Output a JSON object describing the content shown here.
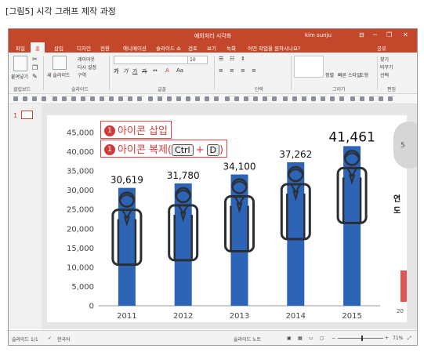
{
  "caption": "[그림5] 시각 그래프 제작 과정",
  "window": {
    "title": "예외처리 시각화",
    "user": "kim sunju",
    "buttons": {
      "ribbon_toggle": "⊟",
      "minimize": "─",
      "restore": "❐",
      "close": "✕"
    },
    "accent": "#c3482b"
  },
  "tabs": [
    {
      "label": "파일"
    },
    {
      "label": "홈"
    },
    {
      "label": "삽입"
    },
    {
      "label": "디자인"
    },
    {
      "label": "전환"
    },
    {
      "label": "애니메이션"
    },
    {
      "label": "슬라이드 쇼"
    },
    {
      "label": "검토"
    },
    {
      "label": "보기"
    },
    {
      "label": "녹화"
    },
    {
      "label": "어떤 작업을 원하시나요?"
    }
  ],
  "tabs_extra": {
    "share": "공유"
  },
  "ribbon": {
    "clipboard": {
      "paste": "붙여넣기",
      "group": "클립보드"
    },
    "slides": {
      "new_slide": "새 슬라이드",
      "layout": "레이아웃",
      "reset": "다시 설정",
      "section": "구역",
      "group": "슬라이드"
    },
    "font": {
      "font_name": "",
      "font_size": "10",
      "group": "글꼴"
    },
    "paragraph": {
      "group": "단락"
    },
    "drawing": {
      "arrange": "정렬",
      "quick_styles": "빠른 스타일",
      "shape": "도형",
      "group": "그리기"
    },
    "editing": {
      "find": "찾기",
      "replace": "바꾸기",
      "select": "선택",
      "group": "편집"
    }
  },
  "thumbnail": {
    "number": "1"
  },
  "annotations": {
    "step1_number": "1",
    "step1_text": "아이콘 삽입",
    "step2_number": "1",
    "step2_text": "아이콘 복제(",
    "key1": "Ctrl",
    "plus": "+",
    "key2": "D",
    "close_paren": ")"
  },
  "side_peek": {
    "text": "연도",
    "circle_label": "5",
    "axis_partial": "20"
  },
  "chart_data": {
    "type": "bar",
    "categories": [
      "2011",
      "2012",
      "2013",
      "2014",
      "2015"
    ],
    "values": [
      30619,
      31780,
      34100,
      37262,
      41461
    ],
    "data_labels": [
      "30,619",
      "31,780",
      "34,100",
      "37,262",
      "41,461"
    ],
    "y_ticks": [
      "0",
      "5,000",
      "10,000",
      "15,000",
      "20,000",
      "25,000",
      "30,000",
      "35,000",
      "40,000",
      "45,000"
    ],
    "ylim": [
      0,
      45000
    ],
    "bar_color": "#2d64b5",
    "icon_color": "#2b2f33",
    "title": "",
    "xlabel": "",
    "ylabel": ""
  },
  "status": {
    "slide_info": "슬라이드 1/1",
    "language": "한국어",
    "notes": "슬라이드 노트",
    "zoom": "71%"
  }
}
